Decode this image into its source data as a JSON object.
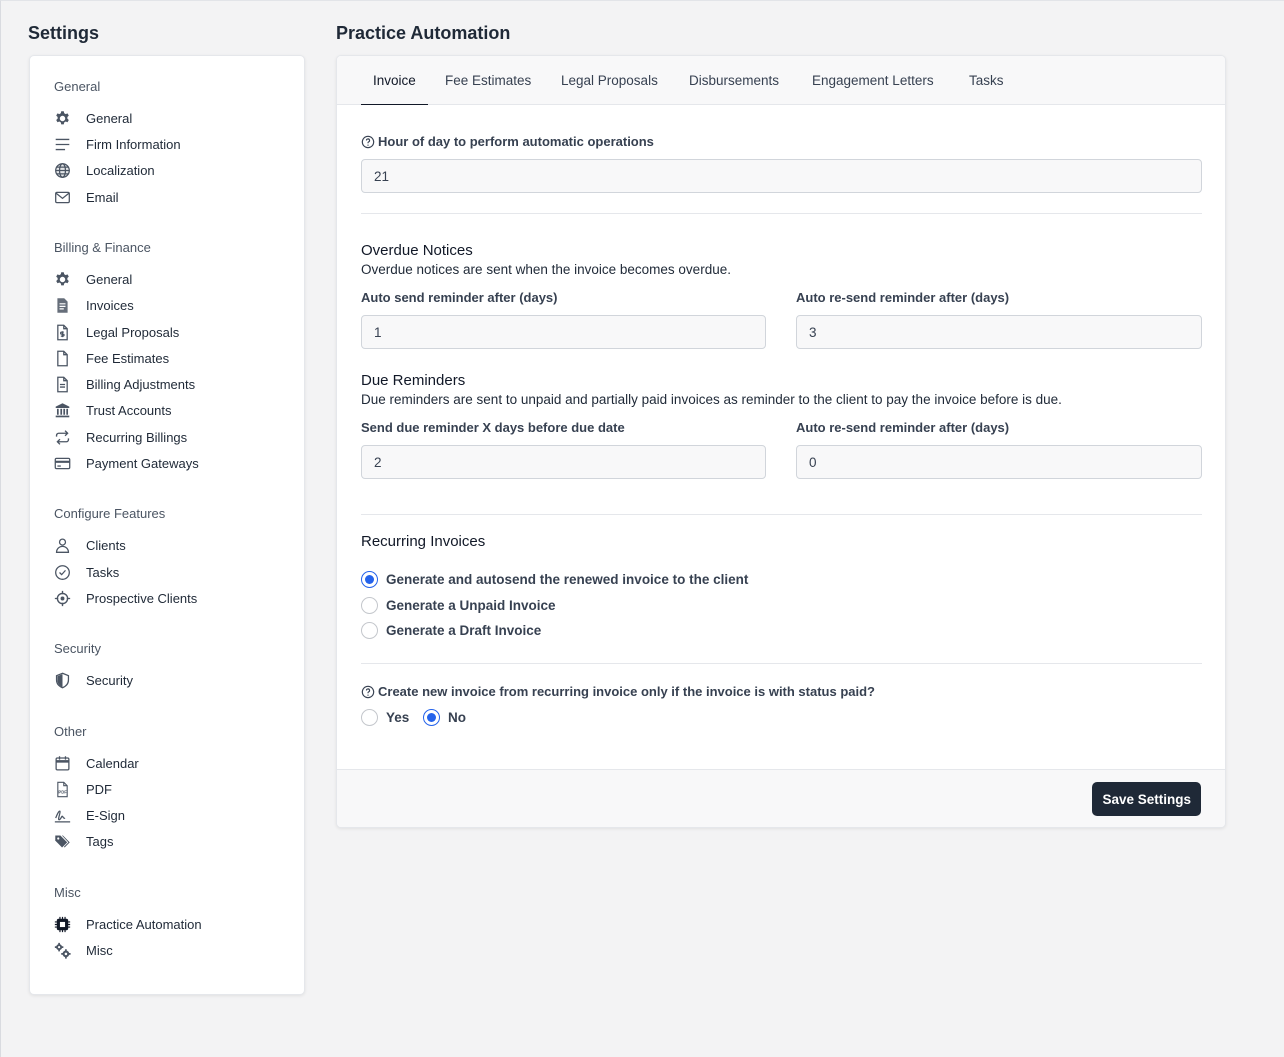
{
  "sidebar": {
    "title": "Settings",
    "groups": [
      {
        "title": "General",
        "items": [
          {
            "label": "General",
            "icon": "gear-icon"
          },
          {
            "label": "Firm Information",
            "icon": "lines-icon"
          },
          {
            "label": "Localization",
            "icon": "globe-icon"
          },
          {
            "label": "Email",
            "icon": "envelope-icon"
          }
        ]
      },
      {
        "title": "Billing & Finance",
        "items": [
          {
            "label": "General",
            "icon": "gear-icon"
          },
          {
            "label": "Invoices",
            "icon": "invoice-icon"
          },
          {
            "label": "Legal Proposals",
            "icon": "document-dollar-icon"
          },
          {
            "label": "Fee Estimates",
            "icon": "file-icon"
          },
          {
            "label": "Billing Adjustments",
            "icon": "document-lines-icon"
          },
          {
            "label": "Trust Accounts",
            "icon": "bank-icon"
          },
          {
            "label": "Recurring Billings",
            "icon": "repeat-icon"
          },
          {
            "label": "Payment Gateways",
            "icon": "credit-card-icon"
          }
        ]
      },
      {
        "title": "Configure Features",
        "items": [
          {
            "label": "Clients",
            "icon": "user-icon"
          },
          {
            "label": "Tasks",
            "icon": "check-circle-icon"
          },
          {
            "label": "Prospective Clients",
            "icon": "crosshair-icon"
          }
        ]
      },
      {
        "title": "Security",
        "items": [
          {
            "label": "Security",
            "icon": "shield-icon"
          }
        ]
      },
      {
        "title": "Other",
        "items": [
          {
            "label": "Calendar",
            "icon": "calendar-icon"
          },
          {
            "label": "PDF",
            "icon": "pdf-icon"
          },
          {
            "label": "E-Sign",
            "icon": "signature-icon"
          },
          {
            "label": "Tags",
            "icon": "tags-icon"
          }
        ]
      },
      {
        "title": "Misc",
        "items": [
          {
            "label": "Practice Automation",
            "icon": "chip-icon"
          },
          {
            "label": "Misc",
            "icon": "gears-icon"
          }
        ]
      }
    ]
  },
  "main": {
    "title": "Practice Automation",
    "tabs": [
      {
        "label": "Invoice",
        "active": true
      },
      {
        "label": "Fee Estimates",
        "active": false
      },
      {
        "label": "Legal Proposals",
        "active": false
      },
      {
        "label": "Disbursements",
        "active": false
      },
      {
        "label": "Engagement Letters",
        "active": false
      },
      {
        "label": "Tasks",
        "active": false
      }
    ],
    "hour": {
      "label": "Hour of day to perform automatic operations",
      "value": "21"
    },
    "overdue": {
      "title": "Overdue Notices",
      "description": "Overdue notices are sent when the invoice becomes overdue.",
      "send_label": "Auto send reminder after (days)",
      "send_value": "1",
      "resend_label": "Auto re-send reminder after (days)",
      "resend_value": "3"
    },
    "due": {
      "title": "Due Reminders",
      "description": "Due reminders are sent to unpaid and partially paid invoices as reminder to the client to pay the invoice before is due.",
      "send_label": "Send due reminder X days before due date",
      "send_value": "2",
      "resend_label": "Auto re-send reminder after (days)",
      "resend_value": "0"
    },
    "recurring": {
      "title": "Recurring Invoices",
      "options": [
        {
          "label": "Generate and autosend the renewed invoice to the client",
          "checked": true
        },
        {
          "label": "Generate a Unpaid Invoice",
          "checked": false
        },
        {
          "label": "Generate a Draft Invoice",
          "checked": false
        }
      ]
    },
    "paid_only": {
      "label": "Create new invoice from recurring invoice only if the invoice is with status paid?",
      "yes_label": "Yes",
      "no_label": "No",
      "selected": "No"
    },
    "save_label": "Save Settings"
  },
  "colors": {
    "accent": "#2563eb",
    "button": "#1f2937",
    "background": "#f3f3f4"
  }
}
